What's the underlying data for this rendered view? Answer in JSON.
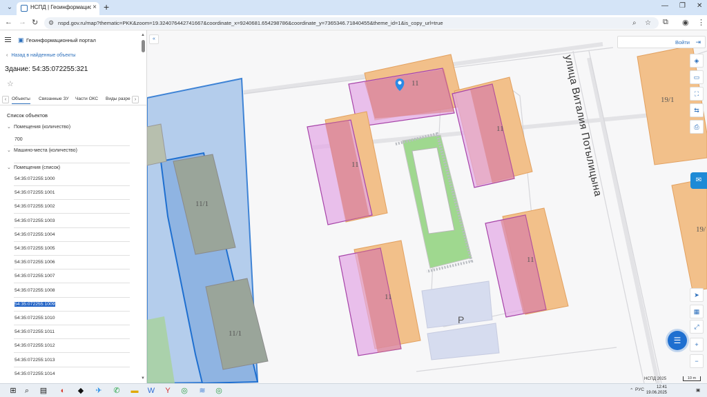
{
  "browser": {
    "tab_title": "НСПД | Геоинформационный",
    "url": "nspd.gov.ru/map?thematic=PKK&zoom=19.324076442741667&coordinate_x=9240681.654298786&coordinate_y=7365346.71840455&theme_id=1&is_copy_url=true"
  },
  "panel": {
    "portal_title": "Геоинформационный портал",
    "back_link": "Назад в найденные объекты",
    "building_title": "Здание: 54:35:072255:321",
    "tabs": [
      "Объекты",
      "Связанные ЗУ",
      "Части ОКС",
      "Виды разреш"
    ],
    "section_title": "Список объектов",
    "groups": [
      {
        "label": "Помещения (количество)",
        "value": "700"
      },
      {
        "label": "Машино-места (количество)"
      },
      {
        "label": "Помещения (список)"
      }
    ],
    "objects": [
      "54:35:072255:1000",
      "54:35:072255:1001",
      "54:35:072255:1002",
      "54:35:072255:1003",
      "54:35:072255:1004",
      "54:35:072255:1005",
      "54:35:072255:1006",
      "54:35:072255:1007",
      "54:35:072255:1008",
      "54:35:072255:1009",
      "54:35:072255:1010",
      "54:35:072255:1011",
      "54:35:072255:1012",
      "54:35:072255:1013",
      "54:35:072255:1014"
    ],
    "selected_object": "54:35:072255:1009"
  },
  "map": {
    "login_label": "Войти",
    "street_label": "улица Виталия Потылицына",
    "building_labels": [
      "11",
      "11",
      "11",
      "11",
      "11",
      "11/1",
      "11/1",
      "19/1",
      "19/"
    ],
    "parking_label": "P",
    "scale_label": "10 m",
    "attribution": "НСПД 2025",
    "colors": {
      "selected_outline": "#1e6fd0",
      "selected_fill": "#4f8fd6",
      "building_orange": "#f2c08a",
      "building_pink": "#e2a6e6"
    }
  },
  "taskbar": {
    "lang": "РУС",
    "time": "12:41",
    "date": "19.06.2025"
  }
}
